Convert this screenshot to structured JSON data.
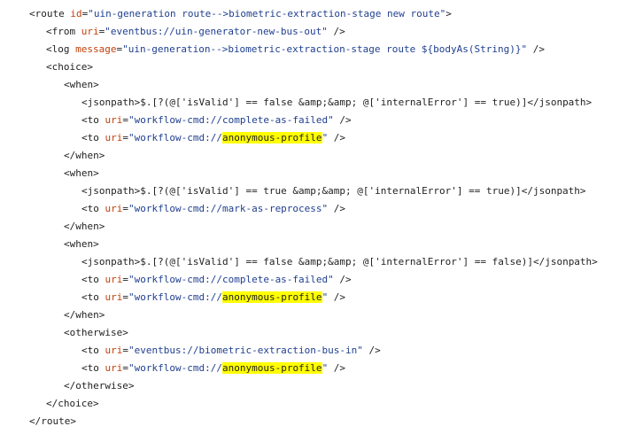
{
  "lines": [
    {
      "t1": "<route ",
      "a1": "id",
      "v1": "\"uin-generation route-->biometric-extraction-stage new route\"",
      "t2": ">"
    },
    {
      "t1": "<from ",
      "a1": "uri",
      "v1": "\"eventbus://uin-generator-new-bus-out\"",
      "t2": " />"
    },
    {
      "t1": "<log ",
      "a1": "message",
      "v1": "\"uin-generation-->biometric-extraction-stage route ${bodyAs(String)}\"",
      "t2": " />"
    },
    {
      "t1": "<choice>"
    },
    {
      "t1": "<when>"
    },
    {
      "t1": "<jsonpath>",
      "txt": "$.[?(@['isValid'] == false &amp;&amp; @['internalError'] == true)]",
      "t2": "</jsonpath>"
    },
    {
      "t1": "<to ",
      "a1": "uri",
      "v1": "\"workflow-cmd://complete-as-failed\"",
      "t2": " />"
    },
    {
      "t1": "<to ",
      "a1": "uri",
      "v1a": "\"workflow-cmd://",
      "hl": "anonymous-profile",
      "v1b": "\"",
      "t2": " />"
    },
    {
      "t1": "</when>"
    },
    {
      "t1": "<when>"
    },
    {
      "t1": "<jsonpath>",
      "txt": "$.[?(@['isValid'] == true &amp;&amp; @['internalError'] == true)]",
      "t2": "</jsonpath>"
    },
    {
      "t1": "<to ",
      "a1": "uri",
      "v1": "\"workflow-cmd://mark-as-reprocess\"",
      "t2": " />"
    },
    {
      "t1": "</when>"
    },
    {
      "t1": "<when>"
    },
    {
      "t1": "<jsonpath>",
      "txt": "$.[?(@['isValid'] == false &amp;&amp; @['internalError'] == false)]",
      "t2": "</jsonpath>"
    },
    {
      "t1": "<to ",
      "a1": "uri",
      "v1": "\"workflow-cmd://complete-as-failed\"",
      "t2": " />"
    },
    {
      "t1": "<to ",
      "a1": "uri",
      "v1a": "\"workflow-cmd://",
      "hl": "anonymous-profile",
      "v1b": "\"",
      "t2": " />"
    },
    {
      "t1": "</when>"
    },
    {
      "t1": "<otherwise>"
    },
    {
      "t1": "<to ",
      "a1": "uri",
      "v1": "\"eventbus://biometric-extraction-bus-in\"",
      "t2": " />"
    },
    {
      "t1": "<to ",
      "a1": "uri",
      "v1a": "\"workflow-cmd://",
      "hl": "anonymous-profile",
      "v1b": "\"",
      "t2": " />"
    },
    {
      "t1": "</otherwise>"
    },
    {
      "t1": "</choice>"
    },
    {
      "t1": "</route>"
    }
  ]
}
